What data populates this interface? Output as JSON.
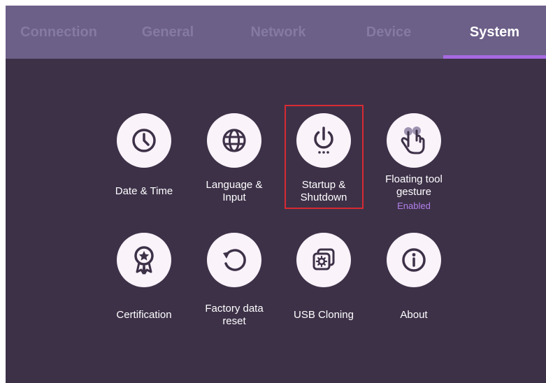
{
  "tabs": [
    {
      "label": "Connection"
    },
    {
      "label": "General"
    },
    {
      "label": "Network"
    },
    {
      "label": "Device"
    },
    {
      "label": "System",
      "active": true
    }
  ],
  "colors": {
    "background": "#3d3148",
    "tabbar": "#6c5f88",
    "active_underline": "#a66ae0",
    "highlight_border": "#d72a32",
    "tile_circle": "#faf3fa",
    "icon": "#3d3148",
    "enabled_text": "#b280ea"
  },
  "tiles": [
    {
      "label": "Date & Time",
      "icon": "clock-icon"
    },
    {
      "label": "Language &\nInput",
      "icon": "globe-icon"
    },
    {
      "label": "Startup &\nShutdown",
      "icon": "power-icon",
      "highlighted": true
    },
    {
      "label": "Floating tool\ngesture",
      "icon": "two-finger-gesture-icon",
      "status": "Enabled"
    },
    {
      "label": "Certification",
      "icon": "award-ribbon-icon"
    },
    {
      "label": "Factory data\nreset",
      "icon": "reset-icon"
    },
    {
      "label": "USB Cloning",
      "icon": "usb-cloning-icon"
    },
    {
      "label": "About",
      "icon": "info-icon"
    }
  ]
}
